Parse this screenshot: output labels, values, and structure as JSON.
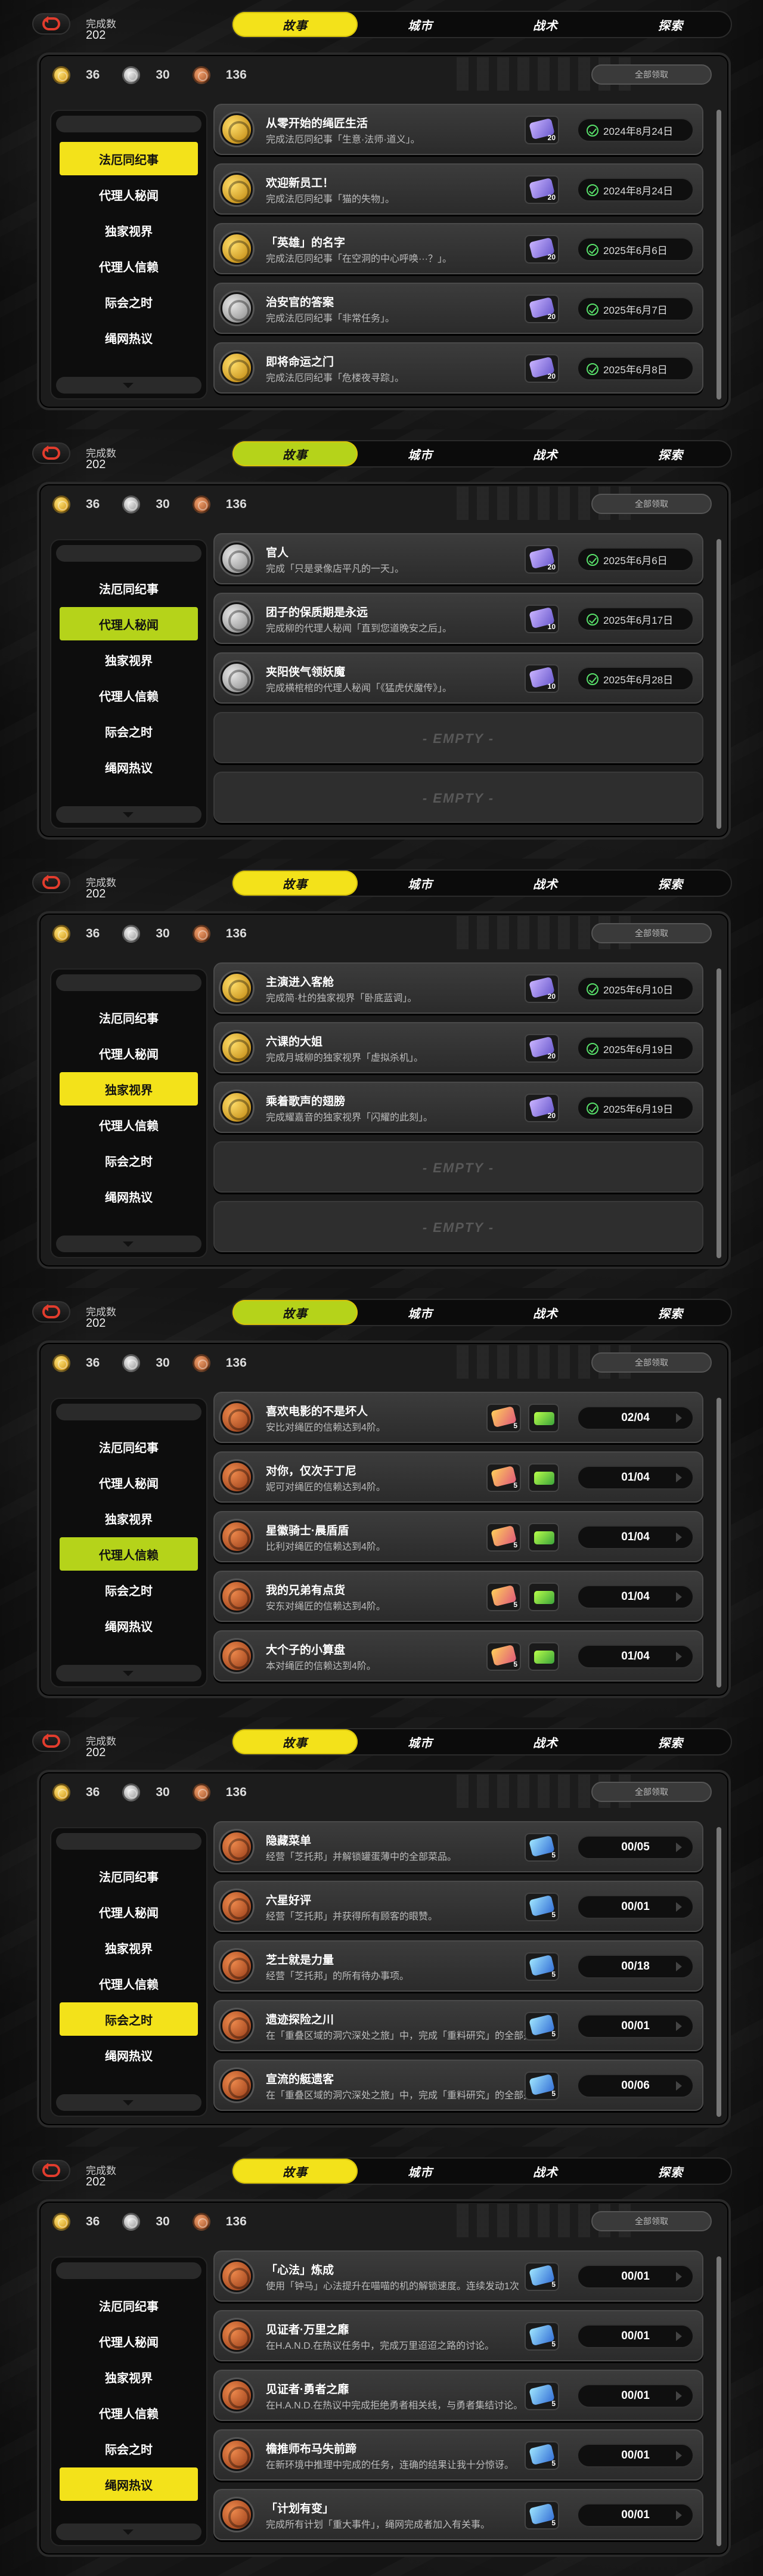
{
  "app": {
    "count_label": "完成数",
    "count_value": "202"
  },
  "tabs": [
    "故事",
    "城市",
    "战术",
    "探索"
  ],
  "stats": {
    "gold": "36",
    "silver": "30",
    "bronze": "136"
  },
  "claim_all": "全部领取",
  "sidebar": [
    "法厄同纪事",
    "代理人秘闻",
    "独家视界",
    "代理人信赖",
    "际会之时",
    "绳网热议"
  ],
  "empty_label": "- EMPTY -",
  "panels": [
    {
      "active_tab": 0,
      "active_side": 0,
      "tab_variant": "yellow",
      "rows": [
        {
          "icon": "gold",
          "title": "从零开始的绳匠生活",
          "desc": "完成法厄同纪事「生意·法师·道义」。",
          "reward": "20",
          "reward_type": "film",
          "date": "2024年8月24日"
        },
        {
          "icon": "gold",
          "title": "欢迎新员工！",
          "desc": "完成法厄同纪事「猫的失物」。",
          "reward": "20",
          "reward_type": "film",
          "date": "2024年8月24日"
        },
        {
          "icon": "gold",
          "title": "「英雄」的名字",
          "desc": "完成法厄同纪事「在空洞的中心呼唤···？」。",
          "reward": "20",
          "reward_type": "film",
          "date": "2025年6月6日"
        },
        {
          "icon": "silver",
          "title": "治安官的答案",
          "desc": "完成法厄同纪事「非常任务」。",
          "reward": "20",
          "reward_type": "film",
          "date": "2025年6月7日"
        },
        {
          "icon": "gold",
          "title": "即将命运之门",
          "desc": "完成法厄同纪事「危楼夜寻踪」。",
          "reward": "20",
          "reward_type": "film",
          "date": "2025年6月8日"
        }
      ]
    },
    {
      "active_tab": 0,
      "active_side": 1,
      "tab_variant": "lime",
      "rows": [
        {
          "icon": "silver",
          "title": "官人",
          "desc": "完成「只是录像店平凡的一天」。",
          "reward": "20",
          "reward_type": "film",
          "date": "2025年6月6日"
        },
        {
          "icon": "silver",
          "title": "团子的保质期是永远",
          "desc": "完成柳的代理人秘闻「直到您道晚安之后」。",
          "reward": "10",
          "reward_type": "film",
          "date": "2025年6月17日"
        },
        {
          "icon": "silver",
          "title": "夹阳侠气领妖魔",
          "desc": "完成横棺棺的代理人秘闻「《猛虎伏魔传》」。",
          "reward": "10",
          "reward_type": "film",
          "date": "2025年6月28日"
        },
        {
          "empty": true
        },
        {
          "empty": true
        }
      ]
    },
    {
      "active_tab": 0,
      "active_side": 2,
      "tab_variant": "yellow",
      "rows": [
        {
          "icon": "gold",
          "title": "主演进入客舱",
          "desc": "完成简·杜的独家视界「卧底蓝调」。",
          "reward": "20",
          "reward_type": "film",
          "date": "2025年6月10日"
        },
        {
          "icon": "gold",
          "title": "六课的大姐",
          "desc": "完成月城柳的独家视界「虚拟杀机」。",
          "reward": "20",
          "reward_type": "film",
          "date": "2025年6月19日"
        },
        {
          "icon": "gold",
          "title": "乘着歌声的翅膀",
          "desc": "完成耀嘉音的独家视界「闪耀的此刻」。",
          "reward": "20",
          "reward_type": "film",
          "date": "2025年6月19日"
        },
        {
          "empty": true
        },
        {
          "empty": true
        }
      ]
    },
    {
      "active_tab": 0,
      "active_side": 3,
      "tab_variant": "lime",
      "progress": true,
      "rows": [
        {
          "icon": "bronze",
          "title": "喜欢电影的不是坏人",
          "desc": "安比对绳匠的信赖达到4阶。",
          "reward": "5",
          "reward_type": "box",
          "progress": "02/04"
        },
        {
          "icon": "bronze",
          "title": "对你，仅次于丁尼",
          "desc": "妮可对绳匠的信赖达到4阶。",
          "reward": "5",
          "reward_type": "box",
          "progress": "01/04"
        },
        {
          "icon": "bronze",
          "title": "星徽骑士·晨盾盾",
          "desc": "比利对绳匠的信赖达到4阶。",
          "reward": "5",
          "reward_type": "box",
          "progress": "01/04"
        },
        {
          "icon": "bronze",
          "title": "我的兄弟有点货",
          "desc": "安东对绳匠的信赖达到4阶。",
          "reward": "5",
          "reward_type": "box",
          "progress": "01/04"
        },
        {
          "icon": "bronze",
          "title": "大个子的小算盘",
          "desc": "本对绳匠的信赖达到4阶。",
          "reward": "5",
          "reward_type": "box",
          "progress": "01/04"
        }
      ]
    },
    {
      "active_tab": 0,
      "active_side": 4,
      "tab_variant": "yellow",
      "progress": true,
      "single": true,
      "rows": [
        {
          "icon": "bronze",
          "title": "隐藏菜单",
          "desc": "经营「芝托邦」并解锁罐蛋薄中的全部菜品。",
          "reward": "5",
          "reward_type": "ticket",
          "progress": "00/05"
        },
        {
          "icon": "bronze",
          "title": "六星好评",
          "desc": "经营「芝托邦」并获得所有顾客的眼赞。",
          "reward": "5",
          "reward_type": "ticket",
          "progress": "00/01"
        },
        {
          "icon": "bronze",
          "title": "芝士就是力量",
          "desc": "经营「芝托邦」的所有待办事项。",
          "reward": "5",
          "reward_type": "ticket",
          "progress": "00/18"
        },
        {
          "icon": "bronze",
          "title": "遗迹探险之川",
          "desc": "在「重叠区域的洞穴深处之旅」中，完成「重料研究」的全部关卡挑战。",
          "reward": "5",
          "reward_type": "ticket",
          "progress": "00/01"
        },
        {
          "icon": "bronze",
          "title": "宣流的艇遗客",
          "desc": "在「重叠区域的洞穴深处之旅」中，完成「重料研究」的全部关卡挑战。",
          "reward": "5",
          "reward_type": "ticket",
          "progress": "00/06"
        }
      ]
    },
    {
      "active_tab": 0,
      "active_side": 5,
      "tab_variant": "yellow",
      "progress": true,
      "single": true,
      "rows": [
        {
          "icon": "bronze",
          "title": "「心法」炼成",
          "desc": "使用「钟马」心法提升在喵喵的机的解锁速度。连续发动1次",
          "reward": "5",
          "reward_type": "ticket",
          "progress": "00/01"
        },
        {
          "icon": "bronze",
          "title": "见证者·万里之靡",
          "desc": "在H.A.N.D.在热议任务中，完成万里迢迢之路的讨论。",
          "reward": "5",
          "reward_type": "ticket",
          "progress": "00/01"
        },
        {
          "icon": "bronze",
          "title": "见证者·勇者之靡",
          "desc": "在H.A.N.D.在热议中完成拒绝勇者相关线，与勇者集结讨论。",
          "reward": "5",
          "reward_type": "ticket",
          "progress": "00/01"
        },
        {
          "icon": "bronze",
          "title": "檐推师布马失前蹄",
          "desc": "在新环境中推理中完成的任务，连确的结果让我十分惊讶。",
          "reward": "5",
          "reward_type": "ticket",
          "progress": "00/01"
        },
        {
          "icon": "bronze",
          "title": "「计划有变」",
          "desc": "完成所有计划「重大事件」，绳网完成者加入有关事。",
          "reward": "5",
          "reward_type": "ticket",
          "progress": "00/01"
        }
      ]
    }
  ]
}
